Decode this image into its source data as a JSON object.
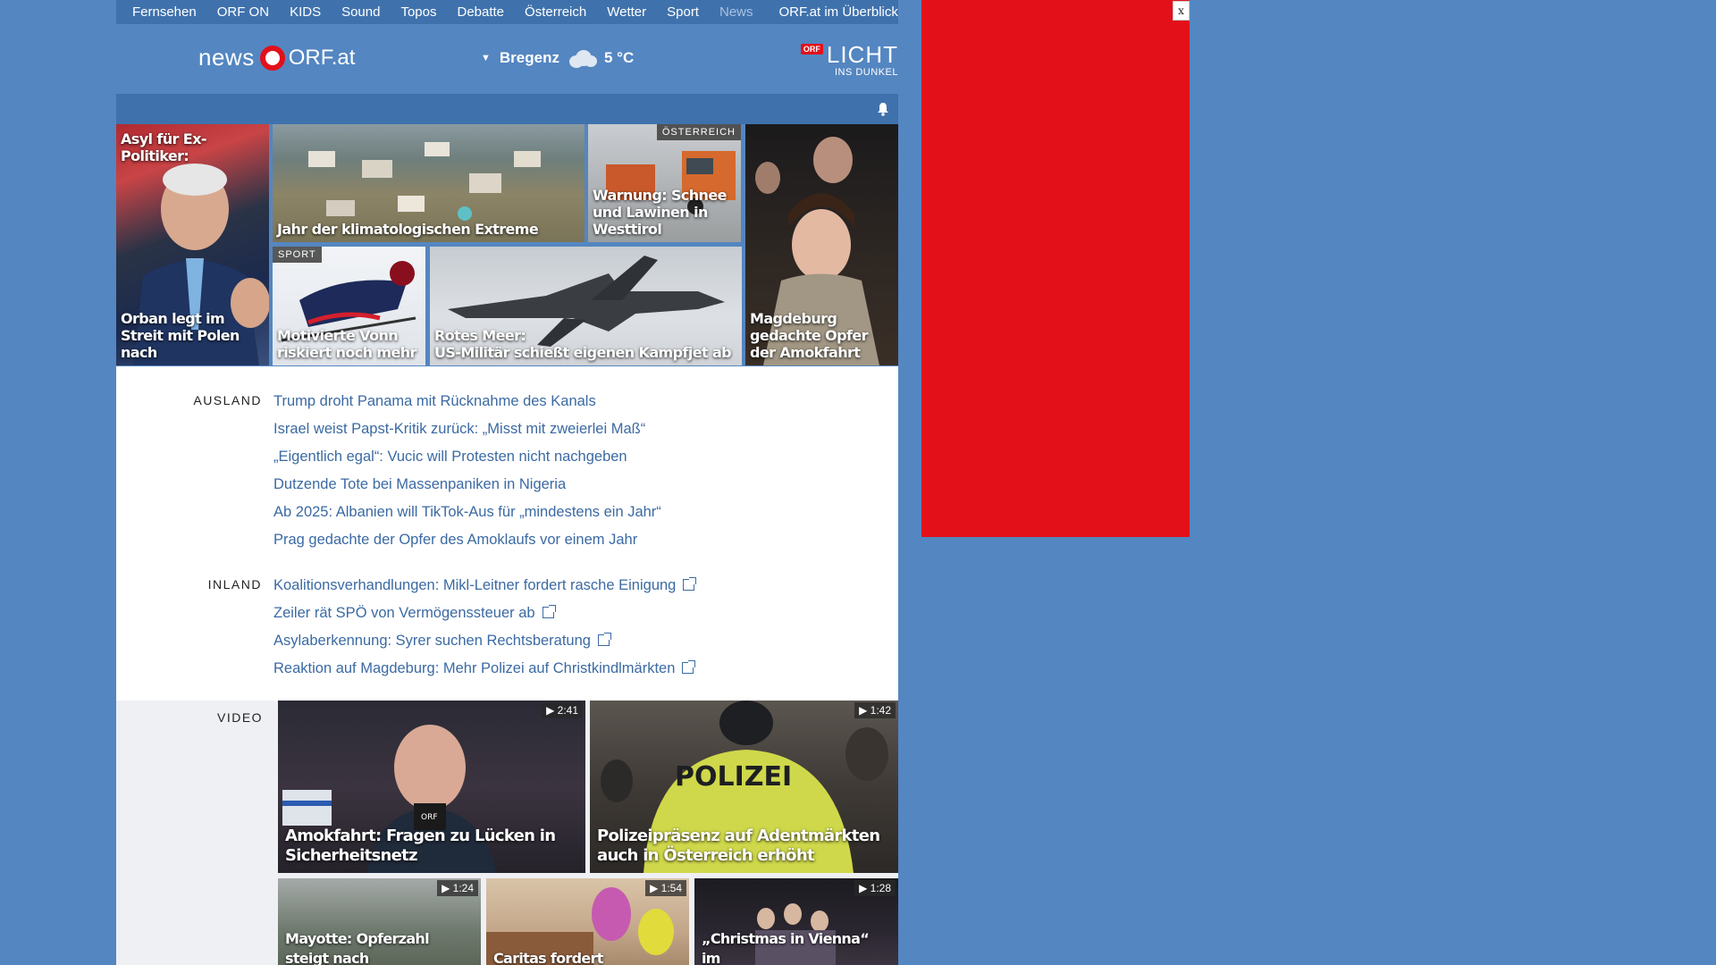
{
  "topnav": {
    "items": [
      "Fernsehen",
      "ORF ON",
      "KIDS",
      "Sound",
      "Topos",
      "Debatte",
      "Österreich",
      "Wetter",
      "Sport",
      "News"
    ],
    "overview": "ORF.at im Überblick"
  },
  "header": {
    "logo_news": "news",
    "logo_orf": "ORF.at",
    "weather_location": "Bregenz",
    "weather_temp": "5 °C",
    "lid_badge": "ORF",
    "lid_title": "LICHT",
    "lid_subtitle": "INS DUNKEL"
  },
  "teasers": {
    "orban_top": "Asyl für Ex-Politiker:",
    "orban_caption": "Orban legt im Streit mit Polen nach",
    "climate_caption": "Jahr der klimatologischen Extreme",
    "snow_tag": "ÖSTERREICH",
    "snow_caption": "Warnung: Schnee und Lawinen in Westtirol",
    "magdeburg_caption": "Magdeburg gedachte Opfer der Amokfahrt",
    "vonn_tag": "SPORT",
    "vonn_caption": "Motivierte Vonn riskiert noch mehr",
    "jet_caption_1": "Rotes Meer:",
    "jet_caption_2": "US-Militär schießt eigenen Kampfjet ab"
  },
  "ausland": {
    "label": "AUSLAND",
    "items": [
      "Trump droht Panama mit Rücknahme des Kanals",
      "Israel weist Papst-Kritik zurück: „Misst mit zweierlei Maß“",
      "„Eigentlich egal“: Vucic will Protesten nicht nachgeben",
      "Dutzende Tote bei Massenpaniken in Nigeria",
      "Ab 2025: Albanien will TikTok-Aus für „mindestens ein Jahr“",
      "Prag gedachte der Opfer des Amoklaufs vor einem Jahr"
    ]
  },
  "inland": {
    "label": "INLAND",
    "items": [
      "Koalitionsverhandlungen: Mikl-Leitner fordert rasche Einigung",
      "Zeiler rät SPÖ von Vermögenssteuer ab",
      "Asylaberkennung: Syrer suchen Rechtsberatung",
      "Reaktion auf Magdeburg: Mehr Polizei auf Christkindlmärkten"
    ]
  },
  "video": {
    "label": "VIDEO",
    "items": [
      {
        "duration": "2:41",
        "caption": "Amokfahrt: Fragen zu Lücken in Sicherheitsnetz"
      },
      {
        "duration": "1:42",
        "caption": "Polizeipräsenz auf Adentmärkten auch in Österreich erhöht"
      },
      {
        "duration": "1:24",
        "caption": "Mayotte: Opferzahl steigt nach"
      },
      {
        "duration": "1:54",
        "caption": "Caritas fordert"
      },
      {
        "duration": "1:28",
        "caption": "„Christmas in Vienna“ im"
      }
    ],
    "polizei_text": "POLIZEI",
    "mic_text": "ORF"
  },
  "ad": {
    "close": "x"
  }
}
